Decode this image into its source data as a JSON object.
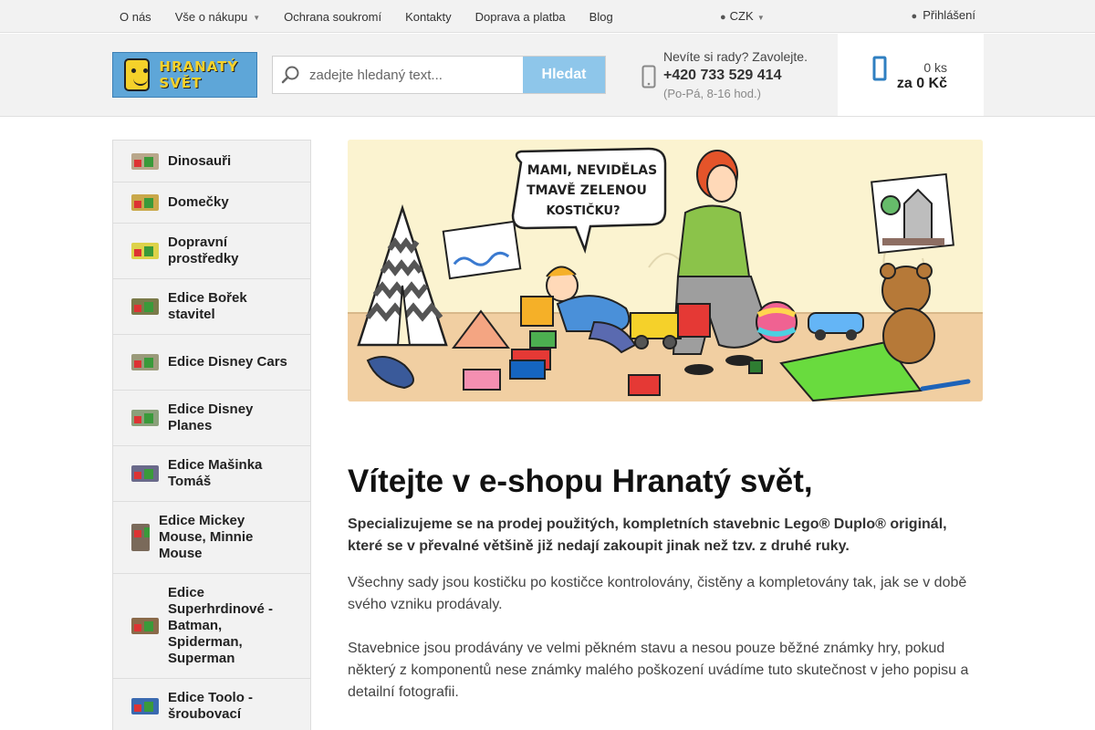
{
  "topnav": {
    "items": [
      {
        "label": "O nás"
      },
      {
        "label": "Vše o nákupu"
      },
      {
        "label": "Ochrana soukromí"
      },
      {
        "label": "Kontakty"
      },
      {
        "label": "Doprava a platba"
      },
      {
        "label": "Blog"
      }
    ],
    "currency": "CZK",
    "login": "Přihlášení"
  },
  "header": {
    "logo_text": "HRANATÝ SVĚT",
    "search": {
      "placeholder": "zadejte hledaný text...",
      "value": "",
      "button": "Hledat"
    },
    "help": {
      "question": "Nevíte si rady? Zavolejte.",
      "phone": "+420 733 529 414",
      "hours": "(Po-Pá, 8-16 hod.)"
    },
    "cart": {
      "count": "0 ks",
      "total": "za 0 Kč"
    }
  },
  "sidebar": {
    "categories": [
      {
        "label": "Dinosauři"
      },
      {
        "label": "Domečky"
      },
      {
        "label": "Dopravní prostředky"
      },
      {
        "label": "Edice Bořek stavitel"
      },
      {
        "label": "Edice Disney Cars"
      },
      {
        "label": "Edice Disney Planes"
      },
      {
        "label": "Edice Mašinka Tomáš"
      },
      {
        "label": "Edice Mickey Mouse, Minnie Mouse"
      },
      {
        "label": "Edice Superhrdinové - Batman, Spiderman, Superman"
      },
      {
        "label": "Edice Toolo - šroubovací"
      }
    ]
  },
  "banner": {
    "speech_line1": "MAMI, NEVIDĚLAS",
    "speech_line2": "TMAVĚ ZELENOU",
    "speech_line3": "KOSTIČKU?"
  },
  "content": {
    "title": "Vítejte v e-shopu Hranatý svět,",
    "lead": "Specializujeme se na prodej použitých, kompletních stavebnic Lego® Duplo® originál, které se v převalné většině již nedají zakoupit jinak než tzv. z druhé ruky.",
    "p1": "Všechny sady jsou kostičku po kostičce kontrolovány, čistěny a kompletovány tak, jak se v době svého vzniku prodávaly.",
    "p2": "Stavebnice jsou prodávány ve velmi pěkném stavu a nesou pouze běžné známky hry, pokud některý z komponentů nese známky malého poškození uvádíme tuto skutečnost v jeho popisu a detailní fotografii."
  }
}
